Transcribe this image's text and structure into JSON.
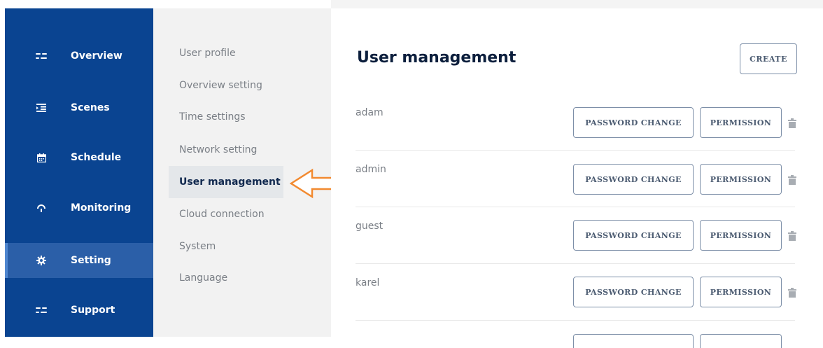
{
  "sidebar": {
    "items": [
      {
        "label": "Overview",
        "icon": "sliders-icon"
      },
      {
        "label": "Scenes",
        "icon": "list-indent-icon"
      },
      {
        "label": "Schedule",
        "icon": "calendar-icon"
      },
      {
        "label": "Monitoring",
        "icon": "gauge-icon"
      },
      {
        "label": "Setting",
        "icon": "gear-icon",
        "active": true
      },
      {
        "label": "Support",
        "icon": "sliders-icon"
      }
    ]
  },
  "submenu": {
    "items": [
      {
        "label": "User profile"
      },
      {
        "label": "Overview setting"
      },
      {
        "label": "Time settings"
      },
      {
        "label": "Network setting"
      },
      {
        "label": "User management",
        "active": true
      },
      {
        "label": "Cloud connection"
      },
      {
        "label": "System"
      },
      {
        "label": "Language"
      }
    ]
  },
  "annotation": {
    "icon": "arrow-left-icon",
    "color": "#f28a30"
  },
  "main": {
    "title": "User management",
    "create_label": "CREATE",
    "users": [
      {
        "name": "adam"
      },
      {
        "name": "admin"
      },
      {
        "name": "guest"
      },
      {
        "name": "karel"
      }
    ],
    "password_change_label": "PASSWORD CHANGE",
    "permission_label": "PERMISSION",
    "delete_icon": "trash-icon"
  },
  "colors": {
    "sidebar": "#0a4491",
    "sidebar_active": "#2b5fa8",
    "submenu": "#f2f2f2",
    "accent": "#f28a30"
  }
}
